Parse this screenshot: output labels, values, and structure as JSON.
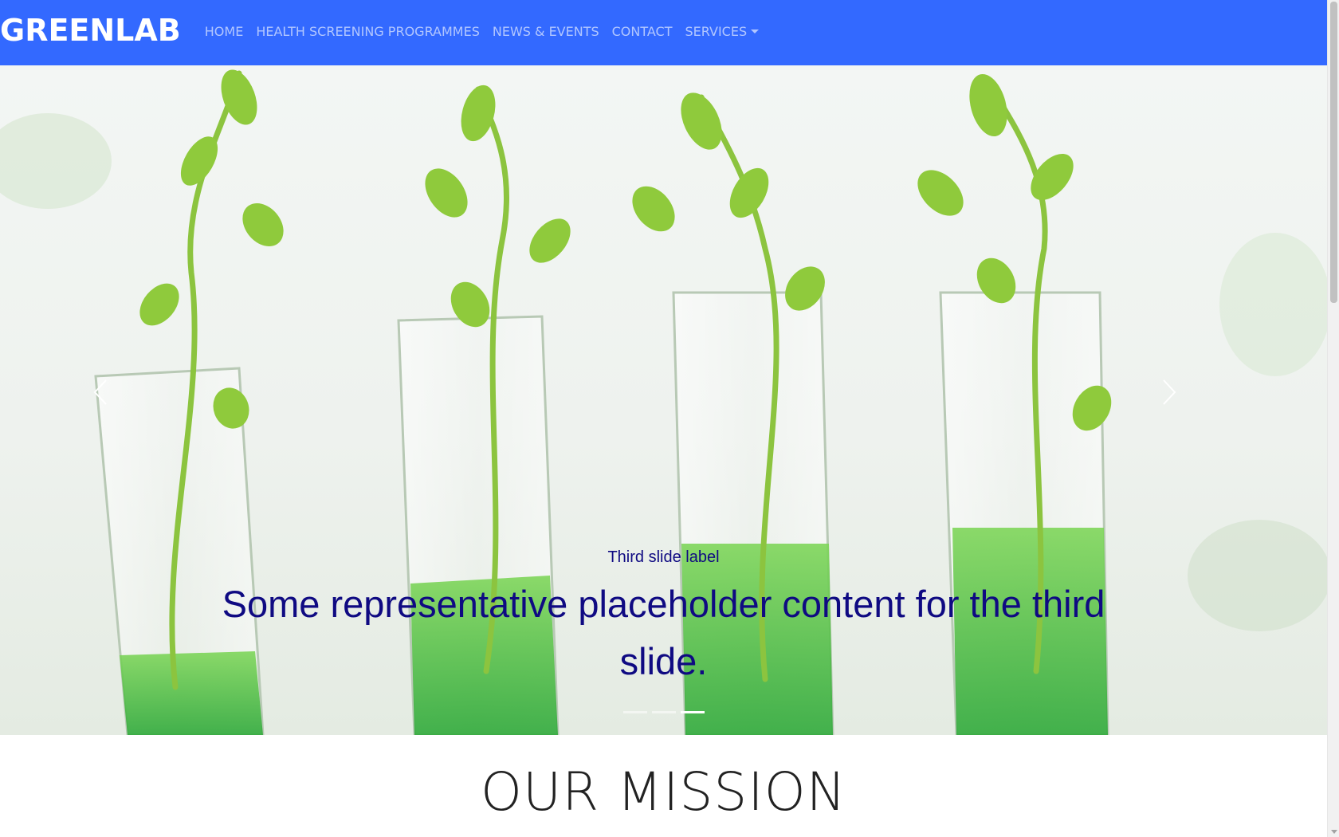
{
  "navbar": {
    "brand": "GREENLAB",
    "links": [
      {
        "label": "HOME"
      },
      {
        "label": "HEALTH SCREENING PROGRAMMES"
      },
      {
        "label": "NEWS & EVENTS"
      },
      {
        "label": "CONTACT"
      },
      {
        "label": "SERVICES"
      }
    ],
    "background_color": "#3369ff"
  },
  "carousel": {
    "caption": {
      "label": "Third slide label",
      "text": "Some representative placeholder content for the third slide."
    },
    "indicators": {
      "count": 3,
      "active": 3
    },
    "controls": {
      "prev_icon": "chevron-left-icon",
      "next_icon": "chevron-right-icon"
    },
    "caption_color": "#0f0a82"
  },
  "mission": {
    "title": "OUR MISSION"
  }
}
